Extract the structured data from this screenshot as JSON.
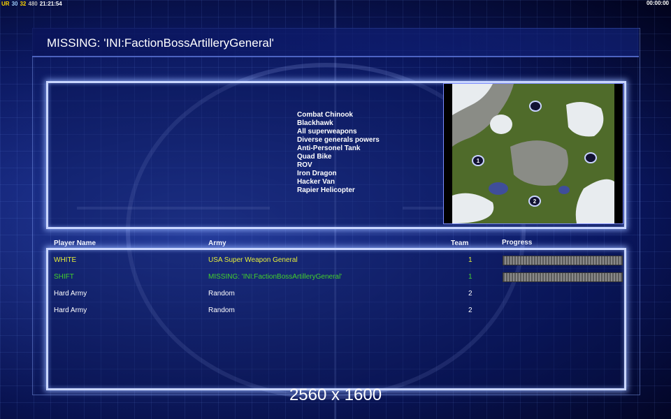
{
  "hud": {
    "left": [
      "UR",
      "30",
      "32",
      "480",
      "21:21:54"
    ],
    "right": "00:00:00"
  },
  "title": "MISSING: 'INI:FactionBossArtilleryGeneral'",
  "unit_list": [
    "Combat Chinook",
    "Blackhawk",
    "All superweapons",
    "Diverse generals powers",
    "Anti-Personel Tank",
    "Quad Bike",
    "ROV",
    "Iron Dragon",
    "Hacker Van",
    "Rapier Helicopter"
  ],
  "minimap": {
    "start_labels": [
      "1",
      "2"
    ],
    "colors": {
      "grass": "#4f6b2a",
      "snow": "#e8ecef",
      "rock": "#8a8c86",
      "water": "#3f4e9a"
    }
  },
  "table": {
    "headers": {
      "player": "Player Name",
      "army": "Army",
      "team": "Team",
      "progress": "Progress"
    },
    "rows": [
      {
        "player": "WHITE",
        "army": "USA Super Weapon General",
        "team": "1",
        "color": "#e6ee3a",
        "progress": true
      },
      {
        "player": "SHIFT",
        "army": "MISSING: 'INI:FactionBossArtilleryGeneral'",
        "team": "1",
        "color": "#43d12b",
        "progress": true
      },
      {
        "player": "Hard Army",
        "army": "Random",
        "team": "2",
        "color": "#ffffff",
        "progress": false
      },
      {
        "player": "Hard Army",
        "army": "Random",
        "team": "2",
        "color": "#ffffff",
        "progress": false
      }
    ]
  },
  "resolution": "2560 x 1600"
}
